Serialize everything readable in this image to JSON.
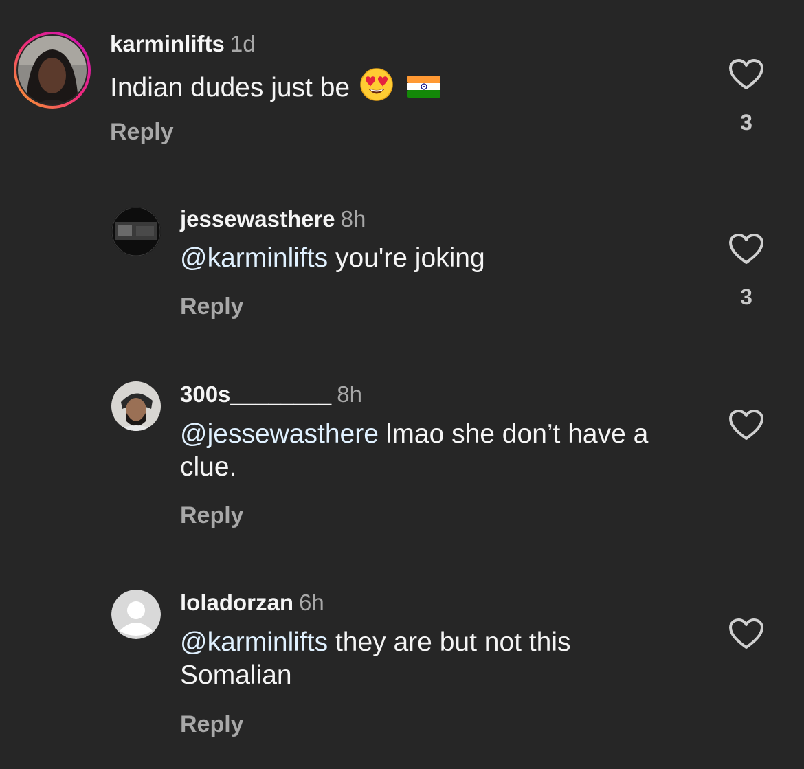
{
  "comments": [
    {
      "username": "karminlifts",
      "time": "1d",
      "text": "Indian dudes just be",
      "emojis": [
        "heart-eyes-emoji",
        "india-flag-emoji"
      ],
      "reply_label": "Reply",
      "likes": "3"
    },
    {
      "username": "jessewasthere",
      "time": "8h",
      "mention": "@karminlifts",
      "text": " you're joking",
      "reply_label": "Reply",
      "likes": "3"
    },
    {
      "username": "300s________",
      "time": "8h",
      "mention": "@jessewasthere",
      "text": " lmao she don’t have a clue.",
      "reply_label": "Reply",
      "likes": ""
    },
    {
      "username": "loladorzan",
      "time": "6h",
      "mention": "@karminlifts",
      "text": " they are but not this Somalian",
      "reply_label": "Reply",
      "likes": ""
    }
  ],
  "colors": {
    "background": "#262626",
    "text": "#f5f5f5",
    "secondary": "#a8a8a8",
    "mention": "#e0f1ff",
    "story_ring_start": "#f9a826",
    "story_ring_end": "#d6249f"
  }
}
